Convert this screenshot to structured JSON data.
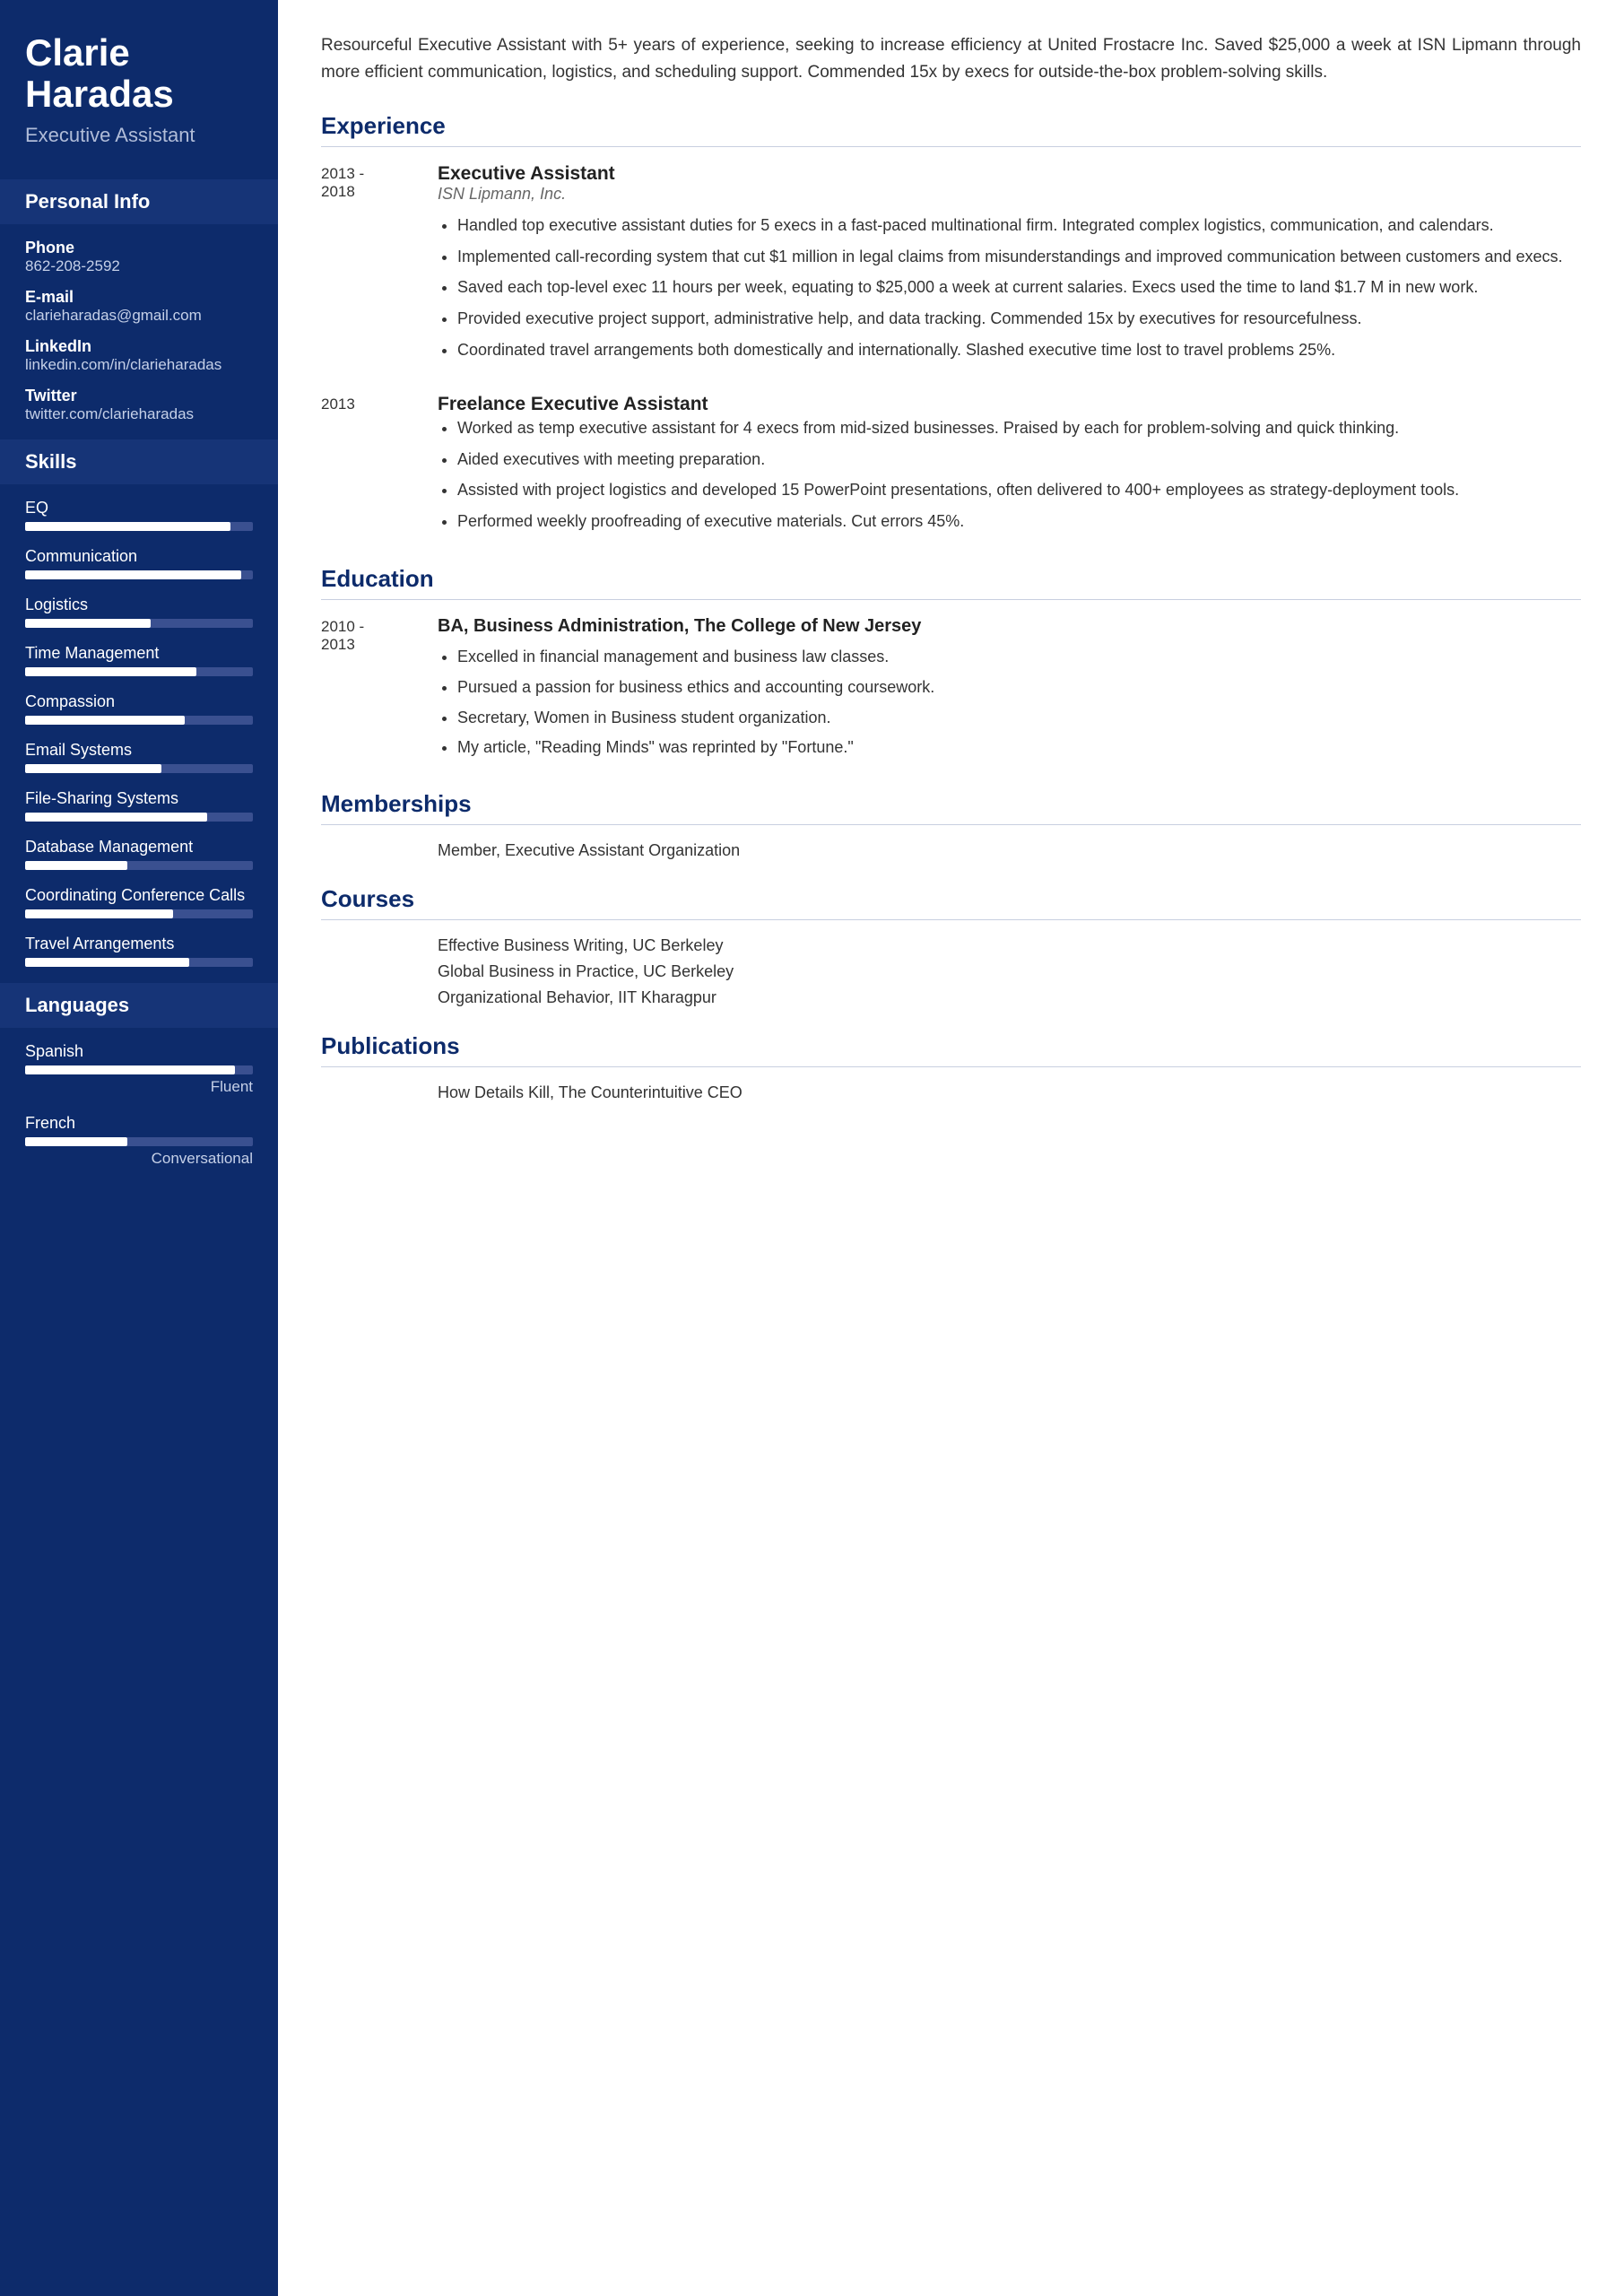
{
  "sidebar": {
    "name": "Clarie\nHaradas",
    "title": "Executive Assistant",
    "personal_info_label": "Personal Info",
    "personal_info": [
      {
        "label": "Phone",
        "value": "862-208-2592"
      },
      {
        "label": "E-mail",
        "value": "clarieharadas@gmail.com"
      },
      {
        "label": "LinkedIn",
        "value": "linkedin.com/in/clarieharadas"
      },
      {
        "label": "Twitter",
        "value": "twitter.com/clarieharadas"
      }
    ],
    "skills_label": "Skills",
    "skills": [
      {
        "name": "EQ",
        "fill": 90
      },
      {
        "name": "Communication",
        "fill": 95
      },
      {
        "name": "Logistics",
        "fill": 55
      },
      {
        "name": "Time Management",
        "fill": 75
      },
      {
        "name": "Compassion",
        "fill": 70
      },
      {
        "name": "Email Systems",
        "fill": 60
      },
      {
        "name": "File-Sharing Systems",
        "fill": 80
      },
      {
        "name": "Database Management",
        "fill": 45
      },
      {
        "name": "Coordinating Conference Calls",
        "fill": 65
      },
      {
        "name": "Travel Arrangements",
        "fill": 72
      }
    ],
    "languages_label": "Languages",
    "languages": [
      {
        "name": "Spanish",
        "fill": 92,
        "level": "Fluent"
      },
      {
        "name": "French",
        "fill": 45,
        "level": "Conversational"
      }
    ]
  },
  "main": {
    "summary": "Resourceful Executive Assistant with 5+ years of experience, seeking to increase efficiency at United Frostacre Inc. Saved $25,000 a week at ISN Lipmann through more efficient communication, logistics, and scheduling support. Commended 15x by execs for outside-the-box problem-solving skills.",
    "experience_label": "Experience",
    "experience": [
      {
        "dates": "2013 -\n2018",
        "title": "Executive Assistant",
        "company": "ISN Lipmann, Inc.",
        "bullets": [
          "Handled top executive assistant duties for 5 execs in a fast-paced multinational firm. Integrated complex logistics, communication, and calendars.",
          "Implemented call-recording system that cut $1 million in legal claims from misunderstandings and improved communication between customers and execs.",
          "Saved each top-level exec 11 hours per week, equating to $25,000 a week at current salaries. Execs used the time to land $1.7 M in new work.",
          "Provided executive project support, administrative help, and data tracking. Commended 15x by executives for resourcefulness.",
          "Coordinated travel arrangements both domestically and internationally. Slashed executive time lost to travel problems 25%."
        ]
      },
      {
        "dates": "2013",
        "title": "Freelance Executive Assistant",
        "company": "",
        "bullets": [
          "Worked as temp executive assistant for 4 execs from mid-sized businesses. Praised by each for problem-solving and quick thinking.",
          "Aided executives with meeting preparation.",
          "Assisted with project logistics and developed 15 PowerPoint presentations, often delivered to 400+ employees as strategy-deployment tools.",
          "Performed weekly proofreading of executive materials. Cut errors 45%."
        ]
      }
    ],
    "education_label": "Education",
    "education": [
      {
        "dates": "2010 -\n2013",
        "degree": "BA, Business Administration, The College of New Jersey",
        "bullets": [
          "Excelled in financial management and business law classes.",
          "Pursued a passion for business ethics and accounting coursework.",
          "Secretary, Women in Business student organization.",
          "My article, \"Reading Minds\" was reprinted by \"Fortune.\""
        ]
      }
    ],
    "memberships_label": "Memberships",
    "memberships": [
      "Member, Executive Assistant Organization"
    ],
    "courses_label": "Courses",
    "courses": [
      "Effective Business Writing, UC Berkeley",
      "Global Business in Practice, UC Berkeley",
      "Organizational Behavior, IIT Kharagpur"
    ],
    "publications_label": "Publications",
    "publications": [
      "How Details Kill, The Counterintuitive CEO"
    ]
  }
}
